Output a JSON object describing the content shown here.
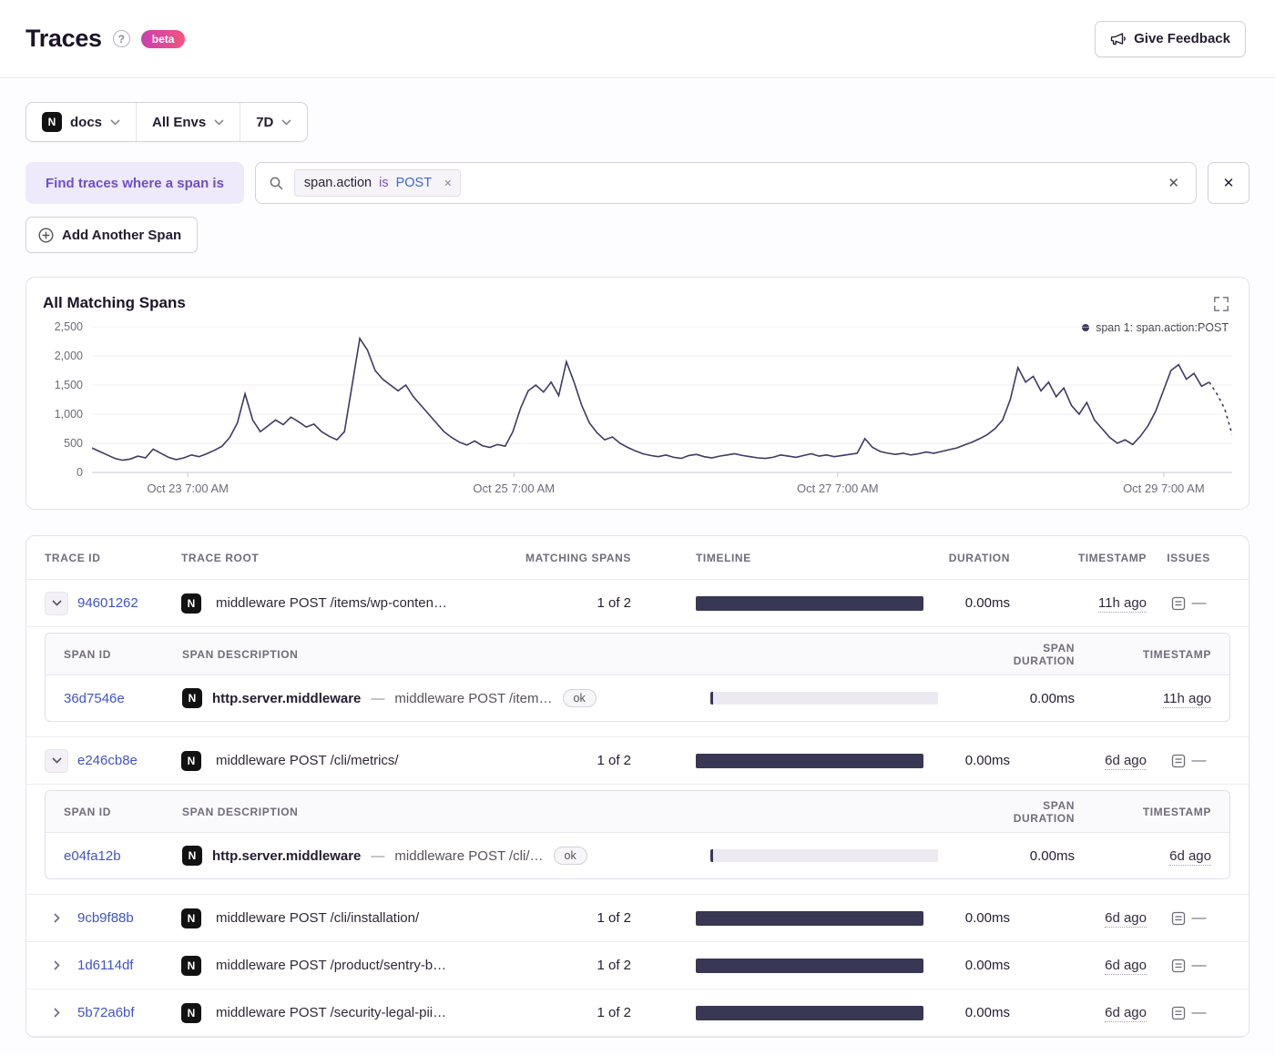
{
  "colors": {
    "link_blue": "#4053c8",
    "accent_purple": "#6d4fc4",
    "purple_bg": "#eee9fb",
    "bar_dark": "#383854",
    "chart_line": "#3d3a63",
    "beta_from": "#cc3fae",
    "beta_to": "#f1567d",
    "token_is": "#7952c6",
    "token_value": "#3a66e0"
  },
  "icons": {
    "logo_letter": "N",
    "close_glyph": "✕",
    "help_glyph": "?",
    "dash": "—"
  },
  "header": {
    "title": "Traces",
    "beta_badge": "beta",
    "feedback_button": "Give Feedback"
  },
  "filters": {
    "project": "docs",
    "environment": "All Envs",
    "period": "7D"
  },
  "query": {
    "label": "Find traces where a span is",
    "token_key": "span.action",
    "token_operator": "is",
    "token_value": "POST",
    "add_span_button": "Add Another Span"
  },
  "chart_data": {
    "type": "line",
    "title": "All Matching Spans",
    "ylim": [
      0,
      2500
    ],
    "y_ticks": [
      0,
      500,
      1000,
      1500,
      2000,
      2500
    ],
    "y_tick_labels": [
      "2,500",
      "2,000",
      "1,500",
      "1,000",
      "500",
      "0"
    ],
    "x_ticks": [
      "Oct 23 7:00 AM",
      "Oct 25 7:00 AM",
      "Oct 27 7:00 AM",
      "Oct 29 7:00 AM"
    ],
    "x_tick_fractions": [
      0.084,
      0.37,
      0.654,
      0.94
    ],
    "legend_position": "top-right",
    "series": [
      {
        "name": "span 1: span.action:POST",
        "values": [
          420,
          360,
          300,
          240,
          210,
          230,
          280,
          250,
          400,
          330,
          260,
          220,
          250,
          300,
          270,
          320,
          380,
          450,
          600,
          850,
          1350,
          900,
          700,
          800,
          900,
          820,
          950,
          870,
          780,
          830,
          700,
          620,
          560,
          700,
          1500,
          2300,
          2100,
          1750,
          1600,
          1500,
          1400,
          1500,
          1300,
          1150,
          1000,
          850,
          700,
          600,
          520,
          470,
          540,
          460,
          430,
          480,
          450,
          700,
          1100,
          1400,
          1500,
          1380,
          1550,
          1320,
          1900,
          1550,
          1150,
          850,
          680,
          560,
          610,
          500,
          430,
          370,
          320,
          290,
          270,
          300,
          260,
          240,
          290,
          310,
          270,
          250,
          280,
          300,
          320,
          290,
          270,
          250,
          240,
          260,
          300,
          280,
          260,
          290,
          320,
          280,
          300,
          270,
          290,
          310,
          330,
          580,
          430,
          360,
          330,
          310,
          330,
          300,
          320,
          350,
          330,
          360,
          390,
          420,
          470,
          520,
          580,
          650,
          750,
          900,
          1250,
          1800,
          1550,
          1650,
          1400,
          1550,
          1300,
          1450,
          1150,
          1000,
          1200,
          900,
          750,
          600,
          500,
          560,
          480,
          620,
          800,
          1050,
          1400,
          1750,
          1850,
          1600,
          1700,
          1480,
          1550,
          1350,
          1100,
          650
        ]
      }
    ]
  },
  "table": {
    "columns": {
      "trace_id": "TRACE ID",
      "trace_root": "TRACE ROOT",
      "matching_spans": "MATCHING SPANS",
      "timeline": "TIMELINE",
      "duration": "DURATION",
      "timestamp": "TIMESTAMP",
      "issues": "ISSUES"
    },
    "sub_columns": {
      "span_id": "SPAN ID",
      "description": "SPAN DESCRIPTION",
      "duration": "SPAN DURATION",
      "timestamp": "TIMESTAMP"
    },
    "rows": [
      {
        "trace_id": "94601262",
        "trace_root": "middleware POST /items/wp-conten…",
        "matching_spans": "1 of 2",
        "duration": "0.00ms",
        "timestamp": "11h ago",
        "expanded": true,
        "spans": [
          {
            "span_id": "36d7546e",
            "operation": "http.server.middleware",
            "description": "middleware POST /item…",
            "status": "ok",
            "duration": "0.00ms",
            "timestamp": "11h ago"
          }
        ]
      },
      {
        "trace_id": "e246cb8e",
        "trace_root": "middleware POST /cli/metrics/",
        "matching_spans": "1 of 2",
        "duration": "0.00ms",
        "timestamp": "6d ago",
        "expanded": true,
        "spans": [
          {
            "span_id": "e04fa12b",
            "operation": "http.server.middleware",
            "description": "middleware POST /cli/…",
            "status": "ok",
            "duration": "0.00ms",
            "timestamp": "6d ago"
          }
        ]
      },
      {
        "trace_id": "9cb9f88b",
        "trace_root": "middleware POST /cli/installation/",
        "matching_spans": "1 of 2",
        "duration": "0.00ms",
        "timestamp": "6d ago",
        "expanded": false,
        "spans": []
      },
      {
        "trace_id": "1d6114df",
        "trace_root": "middleware POST /product/sentry-b…",
        "matching_spans": "1 of 2",
        "duration": "0.00ms",
        "timestamp": "6d ago",
        "expanded": false,
        "spans": []
      },
      {
        "trace_id": "5b72a6bf",
        "trace_root": "middleware POST /security-legal-pii…",
        "matching_spans": "1 of 2",
        "duration": "0.00ms",
        "timestamp": "6d ago",
        "expanded": false,
        "spans": []
      }
    ]
  }
}
